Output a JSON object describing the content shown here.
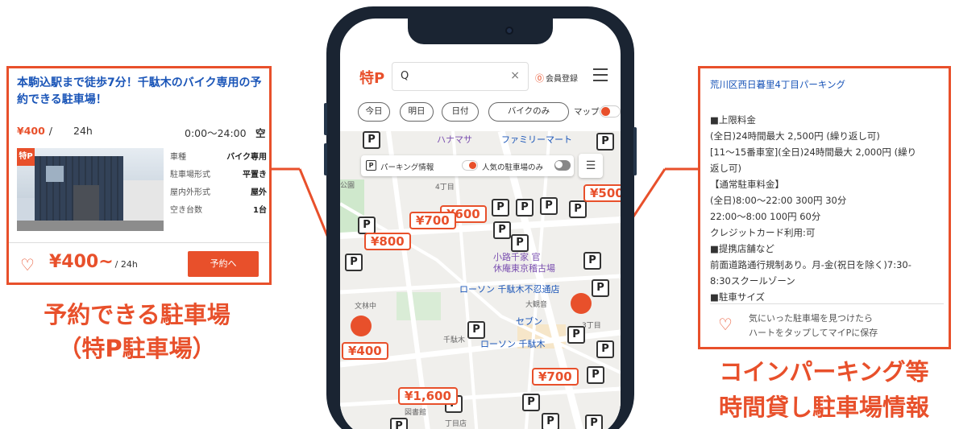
{
  "left_card": {
    "title": "本駒込駅まで徒歩7分！千駄木のバイク専用の予約できる駐車場！",
    "price": "¥400",
    "slash": "/",
    "duration": "24h",
    "hours": "0:00〜24:00",
    "availability": "空",
    "photo_badge": "特P",
    "specs": [
      {
        "key": "車種",
        "value": "バイク専用"
      },
      {
        "key": "駐車場形式",
        "value": "平置き"
      },
      {
        "key": "屋内外形式",
        "value": "屋外"
      },
      {
        "key": "空き台数",
        "value": "1台"
      }
    ],
    "big_price": "¥400~",
    "big_price_unit": "/ 24h",
    "reserve_label": "予約へ",
    "heart_icon": "heart-outline-icon"
  },
  "caption_left": {
    "line1": "予約できる駐車場",
    "line2": "（特P駐車場）"
  },
  "right_card": {
    "title": "荒川区西日暮里4丁目パーキング",
    "lines": [
      "■上限料金",
      "(全日)24時間最大 2,500円 (繰り返し可)",
      "[11〜15番車室](全日)24時間最大 2,000円 (繰り",
      "返し可)",
      "【通常駐車料金】",
      "(全日)8:00〜22:00 300円 30分",
      "22:00〜8:00 100円 60分",
      "クレジットカード利用:可",
      "■提携店舗など",
      "前面道路通行規制あり。月-金(祝日を除く)7:30-",
      "8:30スクールゾーン",
      "■駐車サイズ"
    ],
    "note_line1": "気にいった駐車場を見つけたら",
    "note_line2": "ハートをタップしてマイPに保存"
  },
  "caption_right": {
    "line1": "コインパーキング等",
    "line2": "時間貸し駐車場情報"
  },
  "app": {
    "logo": "特P",
    "search_icon_glyph": "Q",
    "clear_glyph": "×",
    "member_label": "会員登録",
    "filters": [
      "今日",
      "明日",
      "日付",
      "バイクのみ"
    ],
    "map_label": "マップ",
    "legend_parking": "パーキング情報",
    "legend_popular": "人気の駐車場のみ",
    "map_places": [
      "小路千家 官",
      "休庵東京稽古場",
      "ローソン 千駄木不忍通店",
      "セブン",
      "ローソン 千駄木",
      "文林中",
      "千駄木",
      "大観音",
      "ファミリーマート",
      "ハナマサ",
      "4丁目",
      "3丁目",
      "図書館",
      "丁目店",
      "公園"
    ],
    "price_pins": [
      "¥700",
      "¥600",
      "¥800",
      "¥500",
      "¥400",
      "¥700",
      "¥1,600"
    ],
    "p_glyph": "P"
  },
  "colors": {
    "accent": "#e8502b",
    "link": "#1a55b8",
    "phone_frame": "#1a2432"
  }
}
